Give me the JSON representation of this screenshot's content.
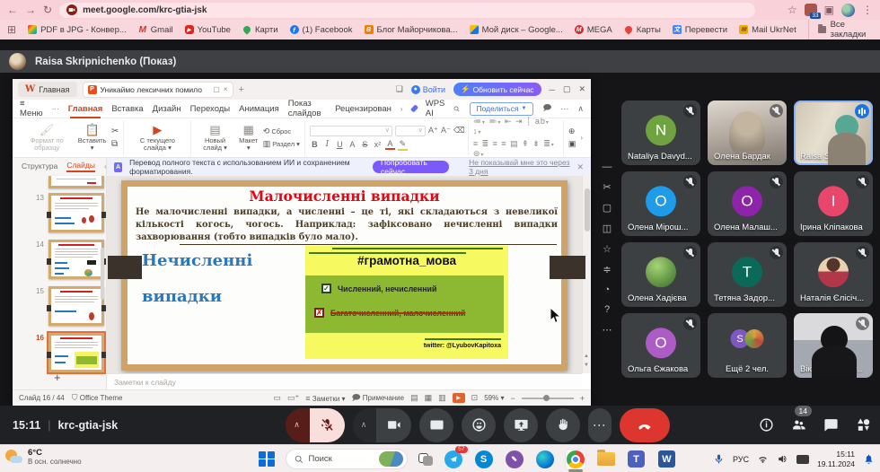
{
  "browser": {
    "url": "meet.google.com/krc-gtia-jsk",
    "extension_badge": "33",
    "bookmarks": [
      {
        "label": "PDF в JPG - Конвер..."
      },
      {
        "label": "Gmail"
      },
      {
        "label": "YouTube"
      },
      {
        "label": "Карти"
      },
      {
        "label": "(1) Facebook"
      },
      {
        "label": "Блог Майорчикова..."
      },
      {
        "label": "Мой диск – Google..."
      },
      {
        "label": "MEGA"
      },
      {
        "label": "Карты"
      },
      {
        "label": "Перевести"
      },
      {
        "label": "Mail UkrNet"
      }
    ],
    "all_bookmarks_label": "Все закладки"
  },
  "meet": {
    "presenter_banner": "Raisa Skripnichenko (Показ)",
    "time": "15:11",
    "meeting_code": "krc-gtia-jsk",
    "participants_badge": "14",
    "participants": [
      {
        "name": "Nataliya Davyd...",
        "initial": "N",
        "avatar_color": "#6ea33f"
      },
      {
        "name": "Олена Бардак"
      },
      {
        "name": "Raisa Skripnic..."
      },
      {
        "name": "Олена Мірош...",
        "initial": "O",
        "avatar_color": "#1e9be9"
      },
      {
        "name": "Олена Малаш...",
        "initial": "O",
        "avatar_color": "#8e24aa"
      },
      {
        "name": "Ірина Кліпакова",
        "initial": "I",
        "avatar_color": "#e8476b"
      },
      {
        "name": "Олена Хадієва"
      },
      {
        "name": "Тетяна Задор...",
        "initial": "T",
        "avatar_color": "#0b695a"
      },
      {
        "name": "Наталія Єлісіч..."
      },
      {
        "name": "Ольга Єжакова",
        "initial": "O",
        "avatar_color": "#ad5cc5"
      },
      {
        "name": "Ещё 2 чел.",
        "initial": "S"
      },
      {
        "name": "Вікторія Майо..."
      }
    ]
  },
  "wps": {
    "home_tab": "Главная",
    "doc_tab": "Уникаймо лексичних помило",
    "menu": "Меню",
    "ribbon_tabs": [
      "Главная",
      "Вставка",
      "Дизайн",
      "Переходы",
      "Анимация",
      "Показ слайдов",
      "Рецензирован"
    ],
    "wps_ai": "WPS AI",
    "sign_in": "Войти",
    "upgrade_button": "Обновить сейчас",
    "share_button": "Поделиться",
    "toolbar": {
      "format_painter": "Формат по образцу",
      "paste": "Вставить",
      "from_current_slide": "С текущего слайда",
      "new_slide": "Новый слайд",
      "layout": "Макет",
      "reset": "Сброс",
      "section": "Раздел"
    },
    "notification": {
      "text": "Перевод полного текста с использованием ИИ и сохранением форматирования.",
      "try_button": "Попробовать сейчас",
      "dismiss_link": "Не показывай мне это через 3 дня"
    },
    "sidebar": {
      "tab_outline": "Структура",
      "tab_slides": "Слайды",
      "thumbnails": [
        "13",
        "14",
        "15",
        "16"
      ]
    },
    "notes_placeholder": "Заметки к слайду",
    "status": {
      "slide_counter": "Слайд 16 / 44",
      "theme": "Office Theme",
      "notes": "Заметки",
      "comment": "Примечание",
      "zoom": "59%"
    }
  },
  "slide": {
    "title": "Малочисленні випадки",
    "body": "Не малочисленні випадки, а численні – це ті, які складаються з невеликої кількості когось, чогось. Наприклад: зафіксовано нечисленні випадки захворювання (тобто випадків було мало).",
    "left_line1": "Нечисленні",
    "left_line2": "випадки",
    "hashtag": "#грамотна_мова",
    "correct_item": "Численний, нечисленний",
    "wrong_item": "Багаточисленний, малочисленний",
    "credit": "twitter: @LyubovKapitoxa"
  },
  "taskbar": {
    "weather_temp": "6°C",
    "weather_desc": "В осн. солнечно",
    "search_placeholder": "Поиск",
    "telegram_badge": "57",
    "lang": "РУС",
    "time": "15:11",
    "date": "19.11.2024"
  },
  "colors": {
    "chrome_pink": "#f8d2d8",
    "meet_bg": "#151517",
    "tile_bg": "#3c4043",
    "speaking_border": "#8ab4f8",
    "end_call_red": "#dc362e",
    "mic_muted_bg": "#f9dedc",
    "wps_accent": "#d3451d",
    "promo_purple": "#7a5af8",
    "slide_title_red": "#e30613",
    "slide_blue": "#2878be",
    "box_yellow": "#f6f960",
    "box_green": "#8cb832"
  },
  "icons": {
    "meet_favicon": "camera-icon",
    "mic_muted": "mic-off-icon",
    "captions": "cc-icon",
    "reactions": "emoji-icon",
    "present": "present-screen-icon",
    "raise_hand": "hand-icon",
    "end_call": "phone-down-icon",
    "people": "people-icon",
    "chat": "chat-icon",
    "activities": "shapes-icon"
  }
}
